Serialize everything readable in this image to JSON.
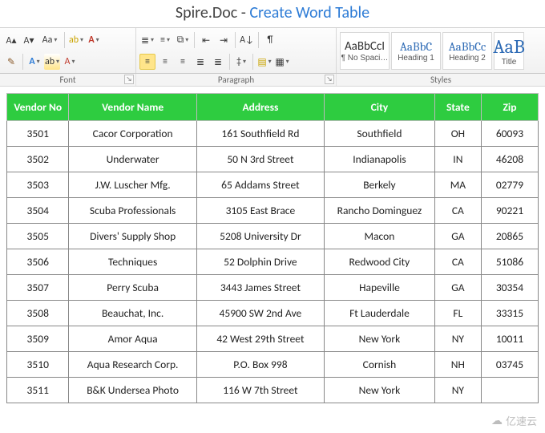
{
  "title": {
    "prefix": "Spire.Doc - ",
    "accent": "Create Word Table"
  },
  "ribbon": {
    "groups": {
      "font": {
        "label": "Font"
      },
      "para": {
        "label": "Paragraph"
      },
      "styles": {
        "label": "Styles"
      }
    },
    "styles_gallery": [
      {
        "sample": "AaBbCcI",
        "name": "¶ No Spaci…",
        "cls": "s0"
      },
      {
        "sample": "AaBbC",
        "name": "Heading 1",
        "cls": ""
      },
      {
        "sample": "AaBbCc",
        "name": "Heading 2",
        "cls": ""
      },
      {
        "sample": "AaB",
        "name": "Title",
        "cls": ""
      }
    ]
  },
  "table": {
    "headers": [
      "Vendor No",
      "Vendor Name",
      "Address",
      "City",
      "State",
      "Zip"
    ],
    "rows": [
      [
        "3501",
        "Cacor Corporation",
        "161 Southfield Rd",
        "Southfield",
        "OH",
        "60093"
      ],
      [
        "3502",
        "Underwater",
        "50 N 3rd Street",
        "Indianapolis",
        "IN",
        "46208"
      ],
      [
        "3503",
        "J.W.  Luscher Mfg.",
        "65 Addams Street",
        "Berkely",
        "MA",
        "02779"
      ],
      [
        "3504",
        "Scuba Professionals",
        "3105 East Brace",
        "Rancho Dominguez",
        "CA",
        "90221"
      ],
      [
        "3505",
        "Divers'  Supply Shop",
        "5208 University Dr",
        "Macon",
        "GA",
        "20865"
      ],
      [
        "3506",
        "Techniques",
        "52 Dolphin Drive",
        "Redwood City",
        "CA",
        "51086"
      ],
      [
        "3507",
        "Perry Scuba",
        "3443 James Street",
        "Hapeville",
        "GA",
        "30354"
      ],
      [
        "3508",
        "Beauchat, Inc.",
        "45900 SW 2nd Ave",
        "Ft Lauderdale",
        "FL",
        "33315"
      ],
      [
        "3509",
        "Amor Aqua",
        "42 West 29th Street",
        "New York",
        "NY",
        "10011"
      ],
      [
        "3510",
        "Aqua Research Corp.",
        "P.O. Box 998",
        "Cornish",
        "NH",
        "03745"
      ],
      [
        "3511",
        "B&K Undersea Photo",
        "116 W 7th Street",
        "New York",
        "NY",
        ""
      ]
    ]
  },
  "watermark": "亿速云"
}
